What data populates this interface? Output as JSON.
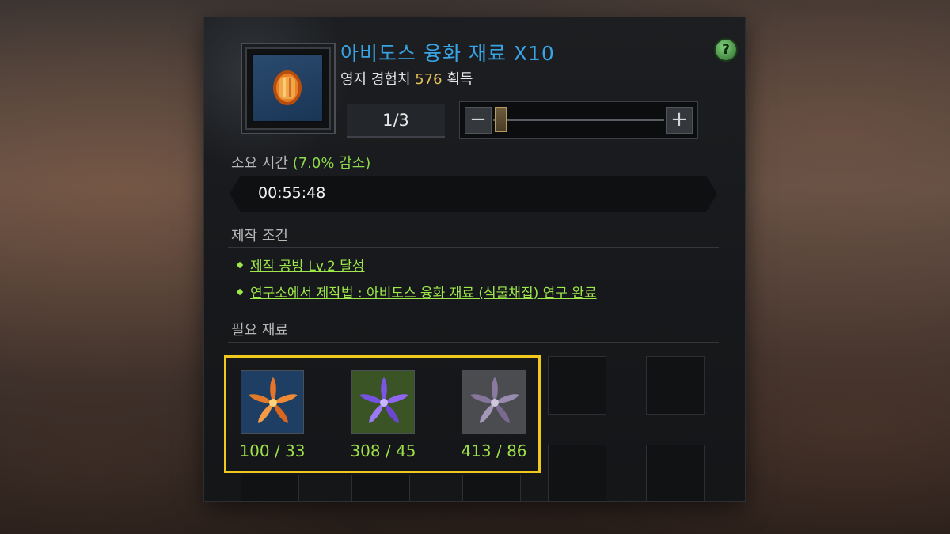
{
  "item": {
    "title": "아비도스 융화 재료 X10",
    "exp_prefix": "영지 경험치 ",
    "exp_value": "576",
    "exp_suffix": " 획득",
    "icon": "orange-gem-icon"
  },
  "help_label": "?",
  "quantity": {
    "display": "1/3",
    "current": 1,
    "max": 3,
    "minus_label": "−",
    "plus_label": "+"
  },
  "time": {
    "label": "소요 시간 ",
    "reduction": "(7.0% 감소)",
    "value": "00:55:48"
  },
  "conditions": {
    "label": "제작 조건",
    "items": [
      "제작 공방 Lv.2 달성",
      "연구소에서 제작법 : 아비도스 융화 재료 (식물채집) 연구 완료"
    ]
  },
  "materials": {
    "label": "필요 재료",
    "items": [
      {
        "icon": "orange-lily-icon",
        "count": "100 / 33",
        "bg": "#1e3f63",
        "petal": "#e8732a"
      },
      {
        "icon": "purple-lily-icon",
        "count": "308 / 45",
        "bg": "#3a5426",
        "petal": "#7c55e6"
      },
      {
        "icon": "gray-lily-icon",
        "count": "413 / 86",
        "bg": "#4a4c50",
        "petal": "#8a7aa0"
      }
    ]
  },
  "colors": {
    "title": "#38a4e6",
    "accent_green": "#9ee84a",
    "exp_gold": "#e8c15a",
    "highlight": "#f0c81e"
  }
}
